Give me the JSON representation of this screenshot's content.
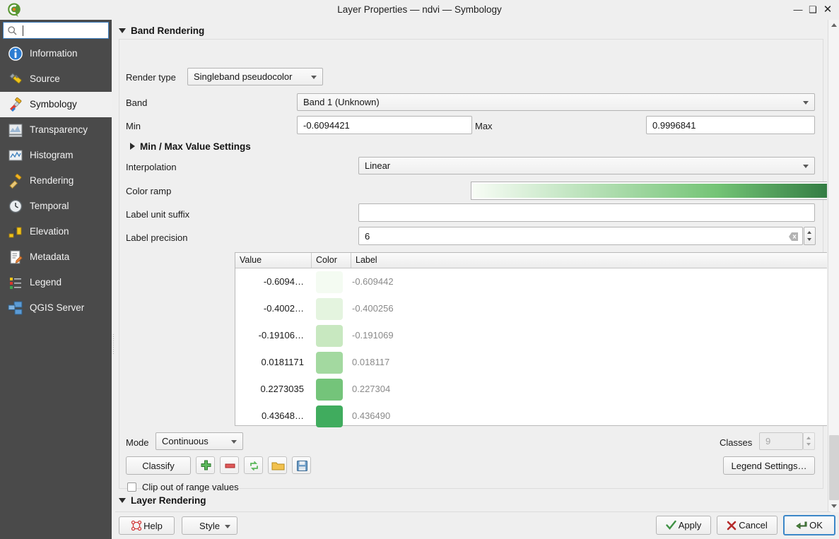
{
  "window": {
    "title": "Layer Properties — ndvi — Symbology",
    "logo_icon": "qgis-logo-icon",
    "minimize_label": "—",
    "maximize_label": "❑",
    "close_label": "✕"
  },
  "sidebar": {
    "search": {
      "value": "",
      "placeholder": "",
      "icon": "search-icon"
    },
    "items": [
      {
        "label": "Information",
        "icon": "information-icon",
        "selected": false
      },
      {
        "label": "Source",
        "icon": "source-icon",
        "selected": false
      },
      {
        "label": "Symbology",
        "icon": "symbology-brush-icon",
        "selected": true
      },
      {
        "label": "Transparency",
        "icon": "transparency-icon",
        "selected": false
      },
      {
        "label": "Histogram",
        "icon": "histogram-icon",
        "selected": false
      },
      {
        "label": "Rendering",
        "icon": "rendering-brush-icon",
        "selected": false
      },
      {
        "label": "Temporal",
        "icon": "clock-icon",
        "selected": false
      },
      {
        "label": "Elevation",
        "icon": "elevation-icon",
        "selected": false
      },
      {
        "label": "Metadata",
        "icon": "metadata-icon",
        "selected": false
      },
      {
        "label": "Legend",
        "icon": "legend-icon",
        "selected": false
      },
      {
        "label": "QGIS Server",
        "icon": "qgis-server-icon",
        "selected": false
      }
    ]
  },
  "band_rendering": {
    "section_title": "Band Rendering",
    "render_type": {
      "label": "Render type",
      "value": "Singleband pseudocolor"
    },
    "band": {
      "label": "Band",
      "value": "Band 1 (Unknown)"
    },
    "min": {
      "label": "Min",
      "value": "-0.6094421"
    },
    "max": {
      "label": "Max",
      "value": "0.9996841"
    },
    "min_max_settings": {
      "label": "Min / Max Value Settings",
      "expanded": false
    },
    "interpolation": {
      "label": "Interpolation",
      "value": "Linear"
    },
    "color_ramp": {
      "label": "Color ramp",
      "name": "Greens",
      "start_color": "#f7fcf5",
      "mid_color": "#74c476",
      "end_color": "#00441b"
    },
    "label_unit_suffix": {
      "label": "Label unit suffix",
      "value": ""
    },
    "label_precision": {
      "label": "Label precision",
      "value": "6",
      "clear_icon": "clear-field-icon"
    },
    "table": {
      "columns": [
        "Value",
        "Color",
        "Label"
      ],
      "rows": [
        {
          "value": "-0.6094…",
          "color": "#f4fbf2",
          "label": "-0.609442"
        },
        {
          "value": "-0.4002…",
          "color": "#e4f4df",
          "label": "-0.400256"
        },
        {
          "value": "-0.19106…",
          "color": "#c8e8c0",
          "label": "-0.191069"
        },
        {
          "value": "0.0181171",
          "color": "#a3d9a0",
          "label": "0.018117"
        },
        {
          "value": "0.2273035",
          "color": "#74c47a",
          "label": "0.227304"
        },
        {
          "value": "0.43648…",
          "color": "#40ac5e",
          "label": "0.436490"
        }
      ]
    },
    "mode": {
      "label": "Mode",
      "value": "Continuous"
    },
    "classes": {
      "label": "Classes",
      "value": "9",
      "enabled": false
    },
    "classify_button": "Classify",
    "legend_settings_button": "Legend Settings…",
    "toolbar_icons": [
      {
        "name": "add-entry-icon",
        "glyph": "plus"
      },
      {
        "name": "remove-entry-icon",
        "glyph": "minus"
      },
      {
        "name": "flip-colors-icon",
        "glyph": "flip"
      },
      {
        "name": "load-color-map-icon",
        "glyph": "folder"
      },
      {
        "name": "save-color-map-icon",
        "glyph": "save"
      }
    ],
    "clip_out_of_range": {
      "label": "Clip out of range values",
      "checked": false
    }
  },
  "layer_rendering": {
    "section_title": "Layer Rendering",
    "expanded": true
  },
  "footer": {
    "help_button": "Help",
    "help_icon": "help-icon",
    "style_button": "Style",
    "apply_button": "Apply",
    "apply_icon": "check-icon",
    "cancel_button": "Cancel",
    "cancel_icon": "cross-icon",
    "ok_button": "OK",
    "ok_icon": "ok-arrow-icon"
  }
}
